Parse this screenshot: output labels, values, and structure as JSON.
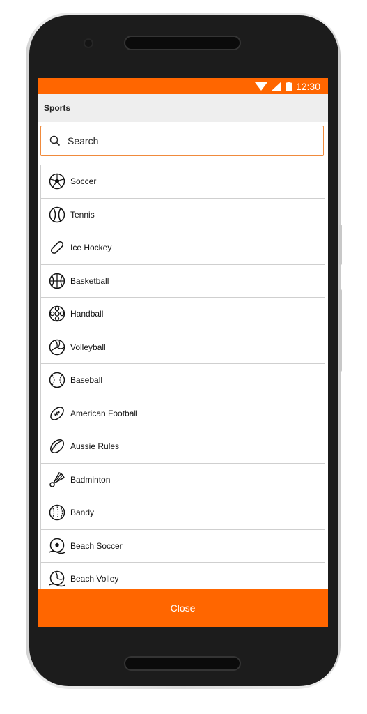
{
  "statusbar": {
    "time": "12:30"
  },
  "appbar": {
    "title": "Sports"
  },
  "search": {
    "placeholder": "Search",
    "icon": "search-icon"
  },
  "sports": [
    {
      "label": "Soccer",
      "icon": "soccer-ball-icon"
    },
    {
      "label": "Tennis",
      "icon": "tennis-ball-icon"
    },
    {
      "label": "Ice Hockey",
      "icon": "hockey-puck-icon"
    },
    {
      "label": "Basketball",
      "icon": "basketball-icon"
    },
    {
      "label": "Handball",
      "icon": "handball-icon"
    },
    {
      "label": "Volleyball",
      "icon": "volleyball-icon"
    },
    {
      "label": "Baseball",
      "icon": "baseball-icon"
    },
    {
      "label": "American Football",
      "icon": "american-football-icon"
    },
    {
      "label": "Aussie Rules",
      "icon": "aussie-rules-ball-icon"
    },
    {
      "label": "Badminton",
      "icon": "shuttlecock-icon"
    },
    {
      "label": "Bandy",
      "icon": "bandy-ball-icon"
    },
    {
      "label": "Beach Soccer",
      "icon": "beach-soccer-icon"
    },
    {
      "label": "Beach Volley",
      "icon": "beach-volley-icon"
    }
  ],
  "footer": {
    "close_label": "Close"
  },
  "colors": {
    "accent": "#ff6600",
    "appbar_bg": "#eeeeee",
    "divider": "#cfcfcf"
  }
}
